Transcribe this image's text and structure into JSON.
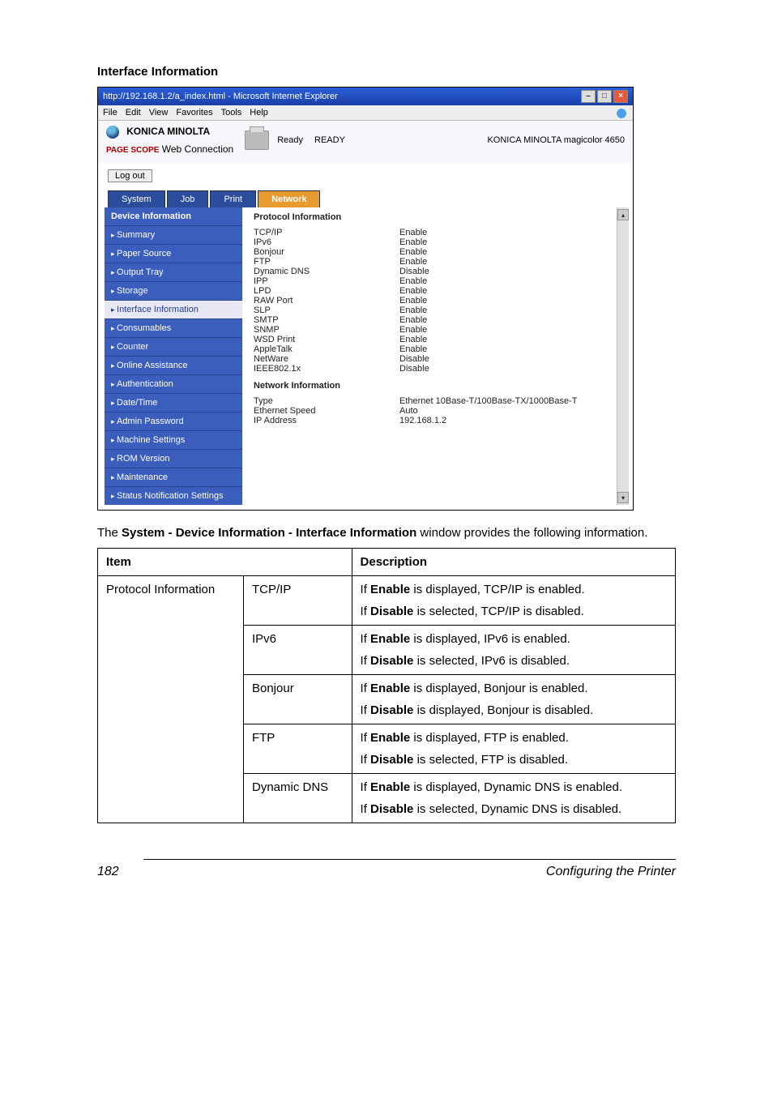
{
  "heading": "Interface Information",
  "browser": {
    "title": "http://192.168.1.2/a_index.html - Microsoft Internet Explorer",
    "menu": {
      "file": "File",
      "edit": "Edit",
      "view": "View",
      "favorites": "Favorites",
      "tools": "Tools",
      "help": "Help"
    },
    "brand": "KONICA MINOLTA",
    "pagescope": "PAGE SCOPE",
    "webconn": "Web Connection",
    "ready_label": "Ready",
    "ready_state": "READY",
    "model": "KONICA MINOLTA magicolor 4650",
    "logout": "Log out",
    "tabs": {
      "system": "System",
      "job": "Job",
      "print": "Print",
      "network": "Network"
    }
  },
  "sidebar": {
    "head": "Device Information",
    "items": [
      {
        "label": "Summary"
      },
      {
        "label": "Paper Source"
      },
      {
        "label": "Output Tray"
      },
      {
        "label": "Storage"
      },
      {
        "label": "Interface Information",
        "active": true
      },
      {
        "label": "Consumables"
      },
      {
        "label": "Counter"
      },
      {
        "label": "Online Assistance"
      },
      {
        "label": "Authentication"
      },
      {
        "label": "Date/Time"
      },
      {
        "label": "Admin Password"
      },
      {
        "label": "Machine Settings"
      },
      {
        "label": "ROM Version"
      },
      {
        "label": "Maintenance"
      },
      {
        "label": "Status Notification Settings"
      }
    ]
  },
  "protocol": {
    "title": "Protocol Information",
    "rows": [
      {
        "k": "TCP/IP",
        "v": "Enable"
      },
      {
        "k": "IPv6",
        "v": "Enable"
      },
      {
        "k": "Bonjour",
        "v": "Enable"
      },
      {
        "k": "FTP",
        "v": "Enable"
      },
      {
        "k": "Dynamic DNS",
        "v": "Disable"
      },
      {
        "k": "IPP",
        "v": "Enable"
      },
      {
        "k": "LPD",
        "v": "Enable"
      },
      {
        "k": "RAW Port",
        "v": "Enable"
      },
      {
        "k": "SLP",
        "v": "Enable"
      },
      {
        "k": "SMTP",
        "v": "Enable"
      },
      {
        "k": "SNMP",
        "v": "Enable"
      },
      {
        "k": "WSD Print",
        "v": "Enable"
      },
      {
        "k": "AppleTalk",
        "v": "Enable"
      },
      {
        "k": "NetWare",
        "v": "Disable"
      },
      {
        "k": "IEEE802.1x",
        "v": "Disable"
      }
    ]
  },
  "netinfo": {
    "title": "Network Information",
    "rows": [
      {
        "k": "Type",
        "v": "Ethernet 10Base-T/100Base-TX/1000Base-T"
      },
      {
        "k": "Ethernet Speed",
        "v": "Auto"
      },
      {
        "k": "IP Address",
        "v": "192.168.1.2"
      }
    ]
  },
  "intro_pre": "The ",
  "intro_bold": "System - Device Information - Interface Information",
  "intro_post": " window provides the following information.",
  "table": {
    "h_item": "Item",
    "h_desc": "Description",
    "group": "Protocol Information",
    "rows": [
      {
        "name": "TCP/IP",
        "l1a": "If ",
        "l1b": "Enable",
        "l1c": " is displayed, TCP/IP is enabled.",
        "l2a": "If ",
        "l2b": "Disable",
        "l2c": " is selected, TCP/IP is disabled."
      },
      {
        "name": "IPv6",
        "l1a": "If ",
        "l1b": "Enable",
        "l1c": " is displayed, IPv6 is enabled.",
        "l2a": "If ",
        "l2b": "Disable",
        "l2c": " is selected, IPv6 is disabled."
      },
      {
        "name": "Bonjour",
        "l1a": "If ",
        "l1b": "Enable",
        "l1c": " is displayed, Bonjour is enabled.",
        "l2a": "If ",
        "l2b": "Disable",
        "l2c": " is displayed, Bonjour is disabled."
      },
      {
        "name": "FTP",
        "l1a": "If ",
        "l1b": "Enable",
        "l1c": " is displayed, FTP is enabled.",
        "l2a": "If ",
        "l2b": "Disable",
        "l2c": " is selected, FTP is disabled."
      },
      {
        "name": "Dynamic DNS",
        "l1a": "If ",
        "l1b": "Enable",
        "l1c": " is displayed, Dynamic DNS is enabled.",
        "l2a": "If ",
        "l2b": "Disable",
        "l2c": " is selected, Dynamic DNS is disabled."
      }
    ]
  },
  "footer": {
    "page": "182",
    "title": "Configuring the Printer"
  }
}
